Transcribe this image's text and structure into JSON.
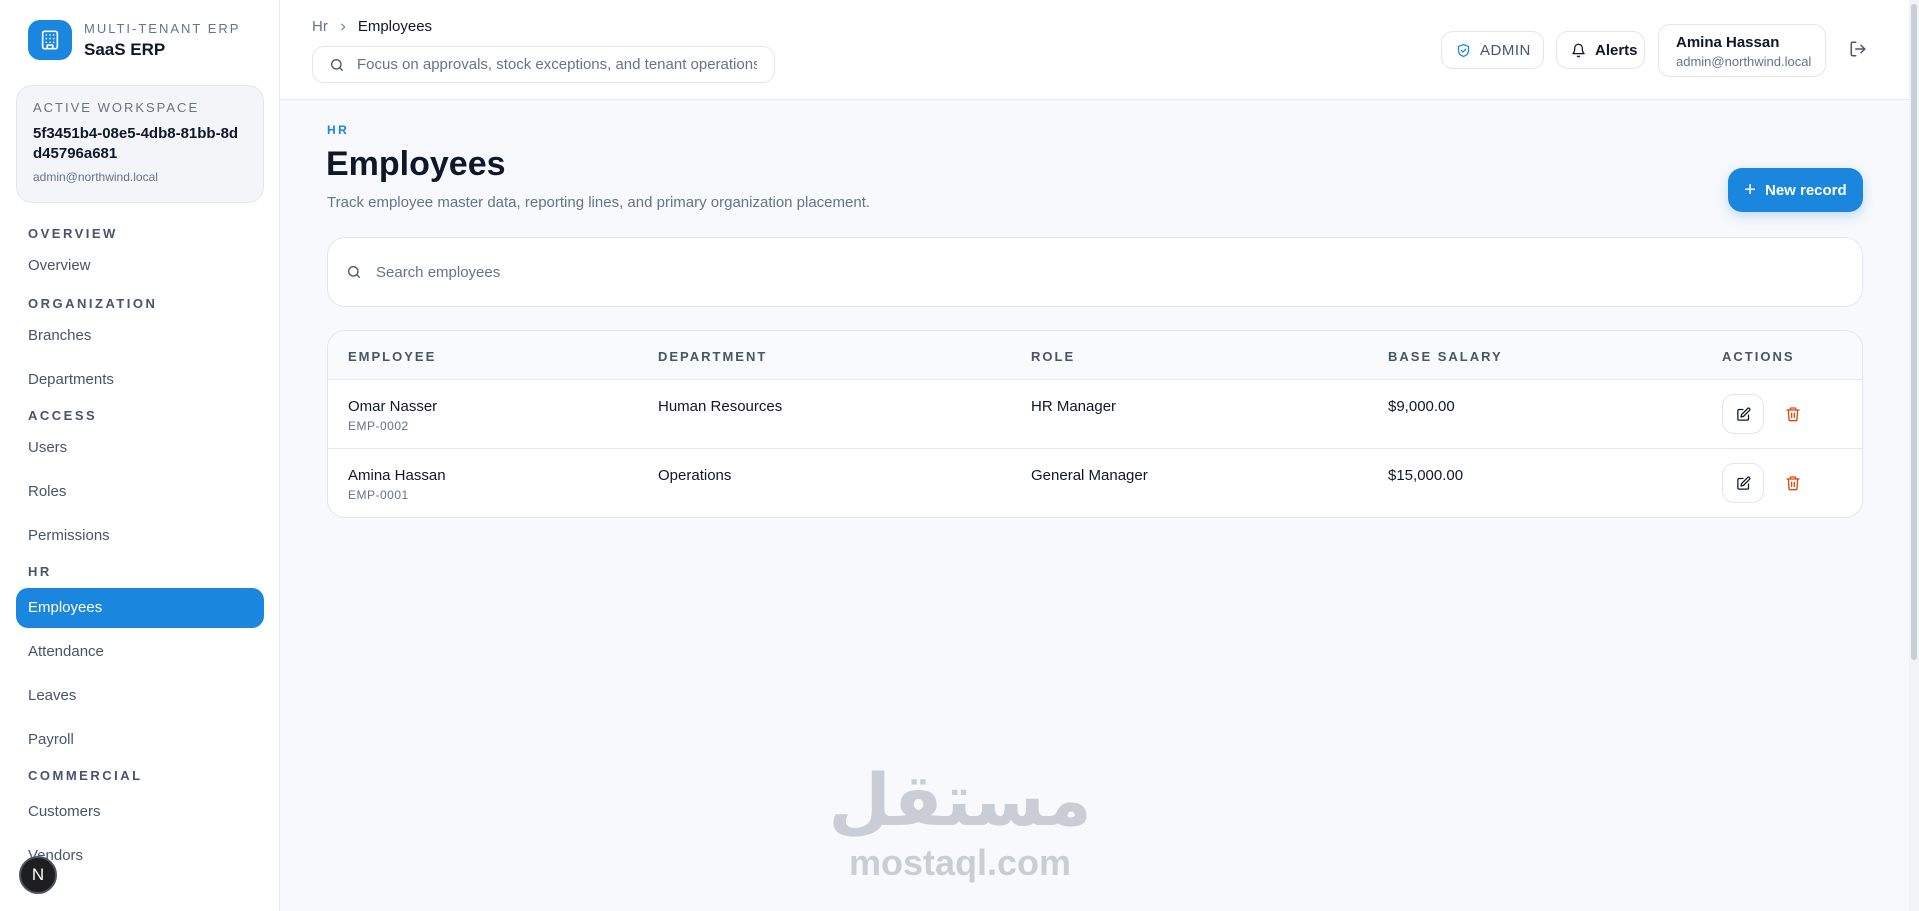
{
  "brand": {
    "subtitle": "MULTI-TENANT ERP",
    "name": "SaaS ERP"
  },
  "workspace": {
    "label": "ACTIVE WORKSPACE",
    "id": "5f3451b4-08e5-4db8-81bb-8dd45796a681",
    "email": "admin@northwind.local"
  },
  "nav": {
    "overview_section": "OVERVIEW",
    "overview": "Overview",
    "organization_section": "ORGANIZATION",
    "branches": "Branches",
    "departments": "Departments",
    "access_section": "ACCESS",
    "users": "Users",
    "roles": "Roles",
    "permissions": "Permissions",
    "hr_section": "HR",
    "employees": "Employees",
    "attendance": "Attendance",
    "leaves": "Leaves",
    "payroll": "Payroll",
    "commercial_section": "COMMERCIAL",
    "customers": "Customers",
    "vendors": "Vendors"
  },
  "badge": "N",
  "topbar": {
    "breadcrumb_root": "Hr",
    "breadcrumb_current": "Employees",
    "search_placeholder": "Focus on approvals, stock exceptions, and tenant operations",
    "role_badge": "ADMIN",
    "alerts_label": "Alerts",
    "user_name": "Amina Hassan",
    "user_email": "admin@northwind.local"
  },
  "page": {
    "eyebrow": "HR",
    "title": "Employees",
    "description": "Track employee master data, reporting lines, and primary organization placement.",
    "new_button": "New record",
    "search_placeholder": "Search employees"
  },
  "table": {
    "headers": [
      "EMPLOYEE",
      "DEPARTMENT",
      "ROLE",
      "BASE SALARY",
      "ACTIONS"
    ],
    "rows": [
      {
        "name": "Omar Nasser",
        "code": "EMP-0002",
        "department": "Human Resources",
        "role": "HR Manager",
        "salary": "$9,000.00"
      },
      {
        "name": "Amina Hassan",
        "code": "EMP-0001",
        "department": "Operations",
        "role": "General Manager",
        "salary": "$15,000.00"
      }
    ]
  },
  "watermark": {
    "arabic": "مستقل",
    "latin": "mostaql.com"
  },
  "colors": {
    "accent": "#1a86dd",
    "danger": "#d9480f",
    "text": "#0f172a",
    "muted": "#64748b"
  },
  "icons": {
    "brand": "building-icon",
    "search": "search-icon",
    "admin": "shield-check-icon",
    "alerts": "bell-icon",
    "logout": "logout-icon",
    "edit": "edit-icon",
    "delete": "trash-icon"
  }
}
